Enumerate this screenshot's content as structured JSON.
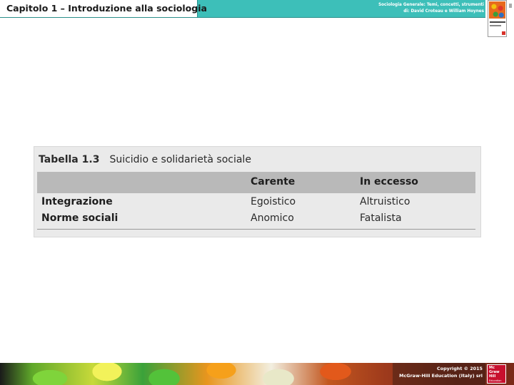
{
  "header": {
    "chapter_title": "Capitolo 1 – Introduzione alla sociologia",
    "book_title": "Sociologia Generale: Temi, concetti, strumenti",
    "book_authors": "di: David Croteau e William Hoynes"
  },
  "table": {
    "number": "Tabella 1.3",
    "title": "Suicidio e solidarietà sociale",
    "columns": [
      "Carente",
      "In eccesso"
    ],
    "rows": [
      {
        "label": "Integrazione",
        "values": [
          "Egoistico",
          "Altruistico"
        ]
      },
      {
        "label": "Norme sociali",
        "values": [
          "Anomico",
          "Fatalista"
        ]
      }
    ]
  },
  "footer": {
    "copyright": "Copyright © 2015",
    "publisher": "McGraw-Hill Education (Italy) srl"
  },
  "logo": {
    "text_lines": [
      "Mc",
      "Graw",
      "Hill"
    ],
    "subtext": "Education"
  },
  "colors": {
    "header_band": "#3dbfb9",
    "table_bg": "#eaeaea",
    "table_header_bg": "#b9b9b9",
    "logo_red": "#c8102e"
  }
}
